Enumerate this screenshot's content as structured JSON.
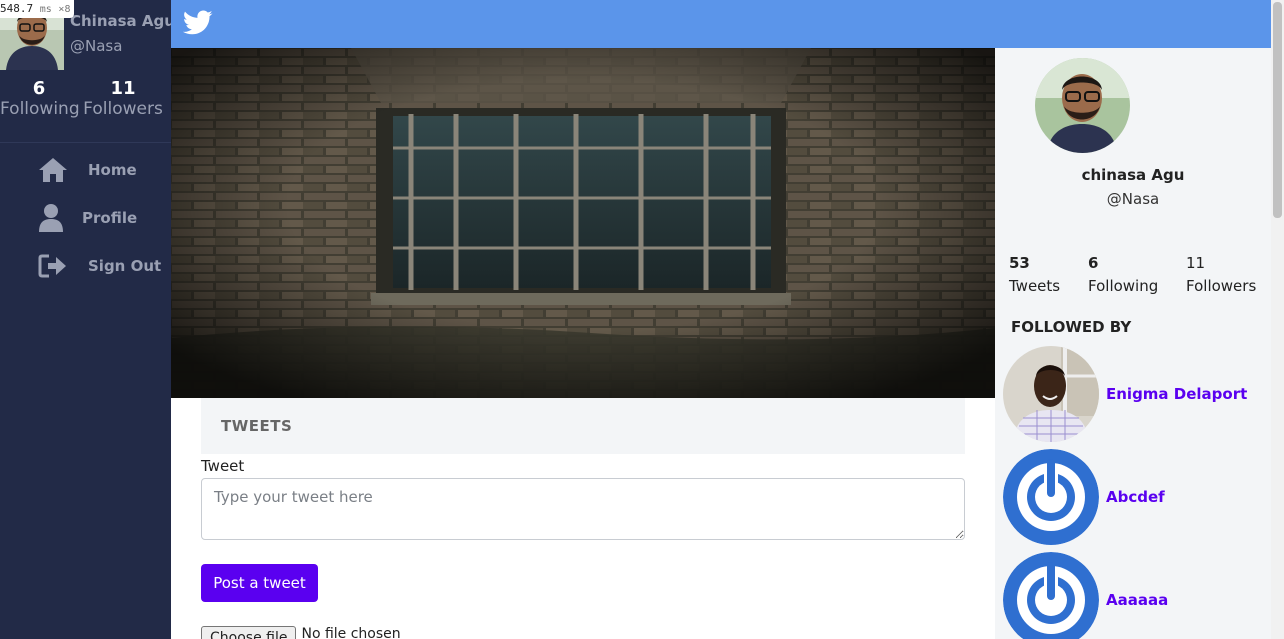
{
  "perf_overlay": {
    "value": "548.7",
    "unit": "ms",
    "multiplier": "×8"
  },
  "sidebar": {
    "user_name": "Chinasa Agu",
    "user_handle": "@Nasa",
    "following_count": "6",
    "following_label": "Following",
    "followers_count": "11",
    "followers_label": "Followers",
    "nav": [
      {
        "label": "Home",
        "icon": "home-icon"
      },
      {
        "label": "Profile",
        "icon": "user-icon"
      },
      {
        "label": "Sign Out",
        "icon": "sign-out-icon"
      }
    ]
  },
  "topbar": {
    "logo": "twitter-bird-icon",
    "color": "#5b95ea"
  },
  "main": {
    "section_title": "TWEETS",
    "tweet_label": "Tweet",
    "tweet_placeholder": "Type your tweet here",
    "post_button": "Post a tweet",
    "file_button": "Choose file",
    "file_status": "No file chosen"
  },
  "profile": {
    "name": "chinasa Agu",
    "handle": "@Nasa",
    "tweets_count": "53",
    "tweets_label": "Tweets",
    "following_count": "6",
    "following_label": "Following",
    "followers_count": "11",
    "followers_label": "Followers",
    "followed_by_title": "FOLLOWED BY",
    "followed_by": [
      {
        "name": "Enigma Delaport",
        "avatar": "photo"
      },
      {
        "name": "Abcdef",
        "avatar": "power-icon"
      },
      {
        "name": "Aaaaaa",
        "avatar": "power-icon"
      }
    ]
  },
  "colors": {
    "sidebar": "#222a47",
    "accent": "#5a00f0",
    "panel": "#f3f5f7"
  }
}
